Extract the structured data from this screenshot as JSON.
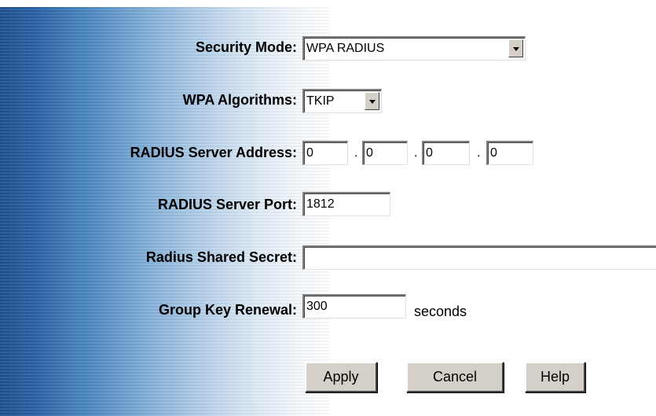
{
  "form": {
    "security_mode": {
      "label": "Security Mode:",
      "value": "WPA RADIUS"
    },
    "wpa_algorithms": {
      "label": "WPA Algorithms:",
      "value": "TKIP"
    },
    "radius_server_address": {
      "label": "RADIUS Server Address:",
      "octets": [
        "0",
        "0",
        "0",
        "0"
      ],
      "separator": "."
    },
    "radius_server_port": {
      "label": "RADIUS Server Port:",
      "value": "1812"
    },
    "radius_shared_secret": {
      "label": "Radius Shared Secret:",
      "value": ""
    },
    "group_key_renewal": {
      "label": "Group Key Renewal:",
      "value": "300",
      "unit": "seconds"
    }
  },
  "buttons": {
    "apply": "Apply",
    "cancel": "Cancel",
    "help": "Help"
  },
  "colors": {
    "gradient_dark": "#1d4f8e",
    "gradient_light": "#ffffff",
    "button_face": "#d4d0c8"
  }
}
